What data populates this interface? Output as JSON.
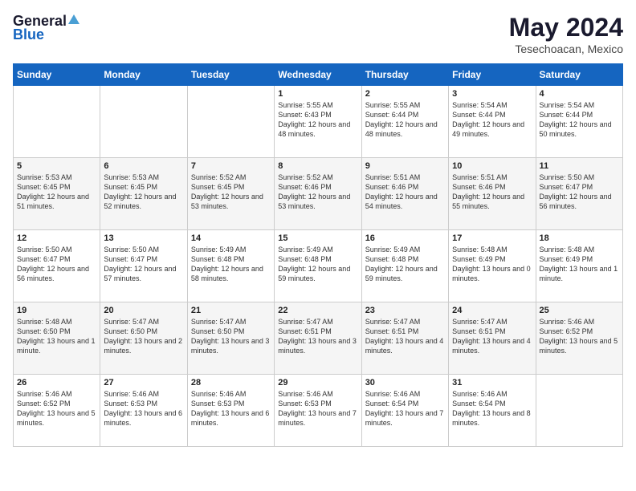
{
  "logo": {
    "general": "General",
    "blue": "Blue"
  },
  "title": "May 2024",
  "location": "Tesechoacan, Mexico",
  "days_of_week": [
    "Sunday",
    "Monday",
    "Tuesday",
    "Wednesday",
    "Thursday",
    "Friday",
    "Saturday"
  ],
  "weeks": [
    [
      {
        "day": "",
        "content": ""
      },
      {
        "day": "",
        "content": ""
      },
      {
        "day": "",
        "content": ""
      },
      {
        "day": "1",
        "content": "Sunrise: 5:55 AM\nSunset: 6:43 PM\nDaylight: 12 hours\nand 48 minutes."
      },
      {
        "day": "2",
        "content": "Sunrise: 5:55 AM\nSunset: 6:44 PM\nDaylight: 12 hours\nand 48 minutes."
      },
      {
        "day": "3",
        "content": "Sunrise: 5:54 AM\nSunset: 6:44 PM\nDaylight: 12 hours\nand 49 minutes."
      },
      {
        "day": "4",
        "content": "Sunrise: 5:54 AM\nSunset: 6:44 PM\nDaylight: 12 hours\nand 50 minutes."
      }
    ],
    [
      {
        "day": "5",
        "content": "Sunrise: 5:53 AM\nSunset: 6:45 PM\nDaylight: 12 hours\nand 51 minutes."
      },
      {
        "day": "6",
        "content": "Sunrise: 5:53 AM\nSunset: 6:45 PM\nDaylight: 12 hours\nand 52 minutes."
      },
      {
        "day": "7",
        "content": "Sunrise: 5:52 AM\nSunset: 6:45 PM\nDaylight: 12 hours\nand 53 minutes."
      },
      {
        "day": "8",
        "content": "Sunrise: 5:52 AM\nSunset: 6:46 PM\nDaylight: 12 hours\nand 53 minutes."
      },
      {
        "day": "9",
        "content": "Sunrise: 5:51 AM\nSunset: 6:46 PM\nDaylight: 12 hours\nand 54 minutes."
      },
      {
        "day": "10",
        "content": "Sunrise: 5:51 AM\nSunset: 6:46 PM\nDaylight: 12 hours\nand 55 minutes."
      },
      {
        "day": "11",
        "content": "Sunrise: 5:50 AM\nSunset: 6:47 PM\nDaylight: 12 hours\nand 56 minutes."
      }
    ],
    [
      {
        "day": "12",
        "content": "Sunrise: 5:50 AM\nSunset: 6:47 PM\nDaylight: 12 hours\nand 56 minutes."
      },
      {
        "day": "13",
        "content": "Sunrise: 5:50 AM\nSunset: 6:47 PM\nDaylight: 12 hours\nand 57 minutes."
      },
      {
        "day": "14",
        "content": "Sunrise: 5:49 AM\nSunset: 6:48 PM\nDaylight: 12 hours\nand 58 minutes."
      },
      {
        "day": "15",
        "content": "Sunrise: 5:49 AM\nSunset: 6:48 PM\nDaylight: 12 hours\nand 59 minutes."
      },
      {
        "day": "16",
        "content": "Sunrise: 5:49 AM\nSunset: 6:48 PM\nDaylight: 12 hours\nand 59 minutes."
      },
      {
        "day": "17",
        "content": "Sunrise: 5:48 AM\nSunset: 6:49 PM\nDaylight: 13 hours\nand 0 minutes."
      },
      {
        "day": "18",
        "content": "Sunrise: 5:48 AM\nSunset: 6:49 PM\nDaylight: 13 hours\nand 1 minute."
      }
    ],
    [
      {
        "day": "19",
        "content": "Sunrise: 5:48 AM\nSunset: 6:50 PM\nDaylight: 13 hours\nand 1 minute."
      },
      {
        "day": "20",
        "content": "Sunrise: 5:47 AM\nSunset: 6:50 PM\nDaylight: 13 hours\nand 2 minutes."
      },
      {
        "day": "21",
        "content": "Sunrise: 5:47 AM\nSunset: 6:50 PM\nDaylight: 13 hours\nand 3 minutes."
      },
      {
        "day": "22",
        "content": "Sunrise: 5:47 AM\nSunset: 6:51 PM\nDaylight: 13 hours\nand 3 minutes."
      },
      {
        "day": "23",
        "content": "Sunrise: 5:47 AM\nSunset: 6:51 PM\nDaylight: 13 hours\nand 4 minutes."
      },
      {
        "day": "24",
        "content": "Sunrise: 5:47 AM\nSunset: 6:51 PM\nDaylight: 13 hours\nand 4 minutes."
      },
      {
        "day": "25",
        "content": "Sunrise: 5:46 AM\nSunset: 6:52 PM\nDaylight: 13 hours\nand 5 minutes."
      }
    ],
    [
      {
        "day": "26",
        "content": "Sunrise: 5:46 AM\nSunset: 6:52 PM\nDaylight: 13 hours\nand 5 minutes."
      },
      {
        "day": "27",
        "content": "Sunrise: 5:46 AM\nSunset: 6:53 PM\nDaylight: 13 hours\nand 6 minutes."
      },
      {
        "day": "28",
        "content": "Sunrise: 5:46 AM\nSunset: 6:53 PM\nDaylight: 13 hours\nand 6 minutes."
      },
      {
        "day": "29",
        "content": "Sunrise: 5:46 AM\nSunset: 6:53 PM\nDaylight: 13 hours\nand 7 minutes."
      },
      {
        "day": "30",
        "content": "Sunrise: 5:46 AM\nSunset: 6:54 PM\nDaylight: 13 hours\nand 7 minutes."
      },
      {
        "day": "31",
        "content": "Sunrise: 5:46 AM\nSunset: 6:54 PM\nDaylight: 13 hours\nand 8 minutes."
      },
      {
        "day": "",
        "content": ""
      }
    ]
  ]
}
